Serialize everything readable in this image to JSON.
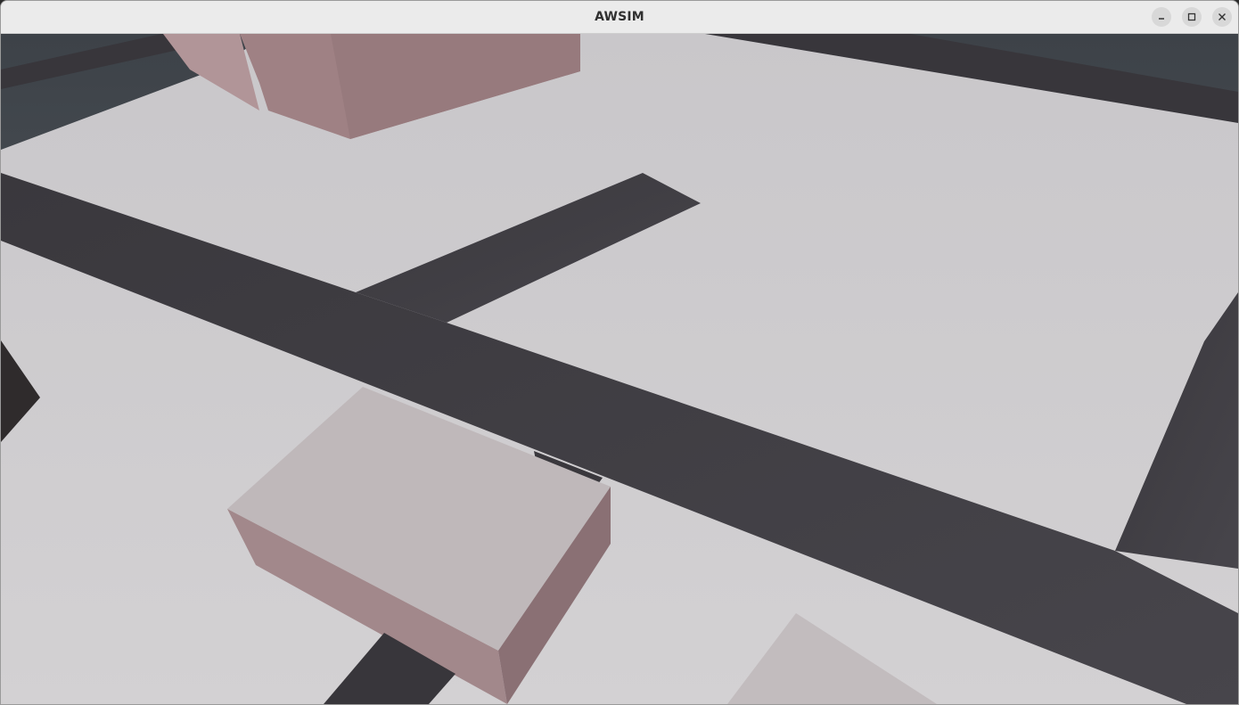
{
  "window": {
    "title": "AWSIM"
  },
  "controls": {
    "minimize_icon": "minimize-icon",
    "maximize_icon": "maximize-icon",
    "close_icon": "close-icon"
  },
  "scene": {
    "description_colors": {
      "ground": "#cdcbcd",
      "road": "#3c3a40",
      "building_top": "#bfb8ba",
      "building_side": "#a2878a",
      "sky": "#4f555b"
    }
  }
}
